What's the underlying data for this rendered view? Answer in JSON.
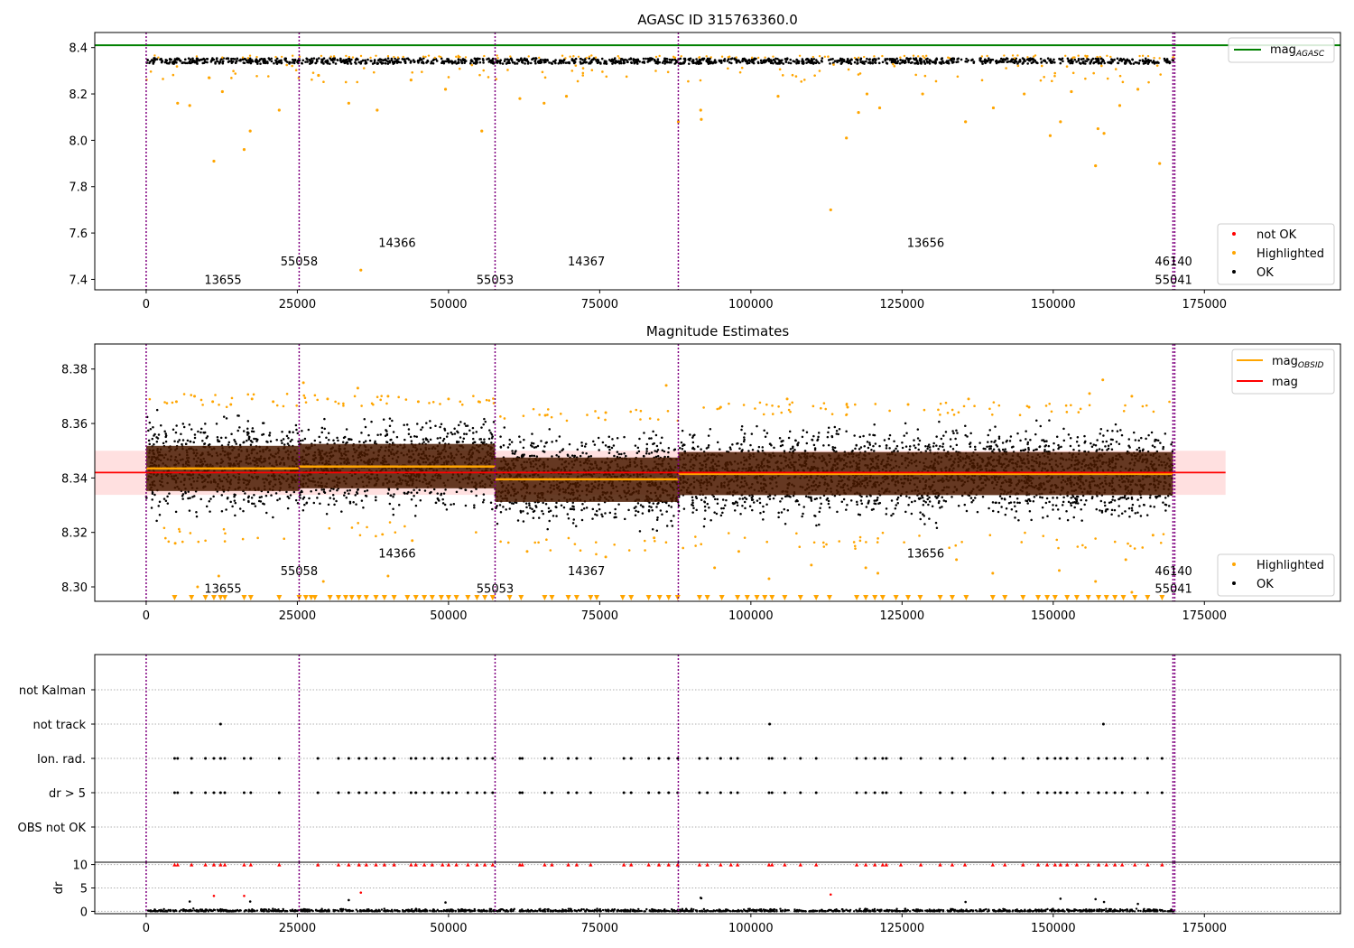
{
  "chart_data": [
    {
      "type": "scatter",
      "title": "AGASC ID 315763360.0",
      "xlabel": "",
      "ylabel": "",
      "xlim": [
        -8500,
        197500
      ],
      "ylim": [
        7.355,
        8.465
      ],
      "xticks": [
        0,
        25000,
        50000,
        75000,
        100000,
        125000,
        150000,
        175000
      ],
      "xtick_labels": [
        "0",
        "25000",
        "50000",
        "75000",
        "100000",
        "125000",
        "150000",
        "175000"
      ],
      "yticks": [
        7.4,
        7.6,
        7.8,
        8.0,
        8.2,
        8.4
      ],
      "ytick_labels": [
        "7.4",
        "7.6",
        "7.8",
        "8.0",
        "8.2",
        "8.4"
      ],
      "obs_boundaries": [
        0,
        25300,
        57700,
        88000,
        169800,
        170100
      ],
      "obsid_labels": [
        {
          "text": "13655",
          "x": 12700,
          "y": 7.4
        },
        {
          "text": "55058",
          "x": 25300,
          "y": 7.48
        },
        {
          "text": "14366",
          "x": 41500,
          "y": 7.56
        },
        {
          "text": "55053",
          "x": 57700,
          "y": 7.4
        },
        {
          "text": "14367",
          "x": 72800,
          "y": 7.48
        },
        {
          "text": "13656",
          "x": 128900,
          "y": 7.56
        },
        {
          "text": "46140",
          "x": 169900,
          "y": 7.48
        },
        {
          "text": "55041",
          "x": 169900,
          "y": 7.4
        }
      ],
      "ref_line": {
        "name": "mag_AGASC",
        "y": 8.41,
        "x": [
          -8500,
          197500
        ],
        "color": "#008000"
      },
      "ok_band": {
        "center": 8.342,
        "half_width": 0.012,
        "color": "#000000"
      },
      "highlighted_outliers": [
        {
          "x": 5200,
          "y": 8.16
        },
        {
          "x": 7200,
          "y": 8.15
        },
        {
          "x": 10400,
          "y": 8.27
        },
        {
          "x": 11200,
          "y": 7.91
        },
        {
          "x": 12600,
          "y": 8.21
        },
        {
          "x": 16200,
          "y": 7.96
        },
        {
          "x": 17200,
          "y": 8.04
        },
        {
          "x": 22000,
          "y": 8.13
        },
        {
          "x": 28500,
          "y": 8.28
        },
        {
          "x": 33500,
          "y": 8.16
        },
        {
          "x": 35500,
          "y": 7.44
        },
        {
          "x": 38200,
          "y": 8.13
        },
        {
          "x": 43800,
          "y": 8.26
        },
        {
          "x": 49500,
          "y": 8.22
        },
        {
          "x": 55500,
          "y": 8.04
        },
        {
          "x": 61800,
          "y": 8.18
        },
        {
          "x": 65800,
          "y": 8.16
        },
        {
          "x": 69500,
          "y": 8.19
        },
        {
          "x": 88000,
          "y": 8.08
        },
        {
          "x": 91700,
          "y": 8.13
        },
        {
          "x": 91800,
          "y": 8.09
        },
        {
          "x": 104500,
          "y": 8.19
        },
        {
          "x": 113200,
          "y": 7.7
        },
        {
          "x": 115800,
          "y": 8.01
        },
        {
          "x": 117800,
          "y": 8.12
        },
        {
          "x": 119200,
          "y": 8.2
        },
        {
          "x": 121300,
          "y": 8.14
        },
        {
          "x": 128400,
          "y": 8.2
        },
        {
          "x": 135500,
          "y": 8.08
        },
        {
          "x": 140100,
          "y": 8.14
        },
        {
          "x": 145200,
          "y": 8.2
        },
        {
          "x": 149500,
          "y": 8.02
        },
        {
          "x": 151200,
          "y": 8.08
        },
        {
          "x": 153000,
          "y": 8.21
        },
        {
          "x": 157000,
          "y": 7.89
        },
        {
          "x": 157400,
          "y": 8.05
        },
        {
          "x": 158400,
          "y": 8.03
        },
        {
          "x": 161000,
          "y": 8.15
        },
        {
          "x": 164000,
          "y": 8.22
        },
        {
          "x": 167600,
          "y": 7.9
        }
      ],
      "legends": [
        {
          "position": "upper-right",
          "entries": [
            {
              "label": "mag",
              "sub": "AGASC",
              "color": "#008000",
              "kind": "line"
            }
          ]
        },
        {
          "position": "lower-right",
          "entries": [
            {
              "label": "not OK",
              "color": "#ff0000",
              "kind": "dot"
            },
            {
              "label": "Highlighted",
              "color": "#ffa500",
              "kind": "dot"
            },
            {
              "label": "OK",
              "color": "#000000",
              "kind": "dot"
            }
          ]
        }
      ]
    },
    {
      "type": "scatter",
      "title": "Magnitude Estimates",
      "xlabel": "",
      "ylabel": "",
      "xlim": [
        -8500,
        197500
      ],
      "ylim": [
        8.2947,
        8.3892
      ],
      "xticks": [
        0,
        25000,
        50000,
        75000,
        100000,
        125000,
        150000,
        175000
      ],
      "xtick_labels": [
        "0",
        "25000",
        "50000",
        "75000",
        "100000",
        "125000",
        "150000",
        "175000"
      ],
      "yticks": [
        8.3,
        8.32,
        8.34,
        8.36,
        8.38
      ],
      "ytick_labels": [
        "8.30",
        "8.32",
        "8.34",
        "8.36",
        "8.38"
      ],
      "obs_boundaries": [
        0,
        25300,
        57700,
        88000,
        169800,
        170100
      ],
      "obsid_labels": [
        {
          "text": "13655",
          "x": 12700,
          "y": 8.2995
        },
        {
          "text": "55058",
          "x": 25300,
          "y": 8.306
        },
        {
          "text": "14366",
          "x": 41500,
          "y": 8.3125
        },
        {
          "text": "55053",
          "x": 57700,
          "y": 8.2995
        },
        {
          "text": "14367",
          "x": 72800,
          "y": 8.306
        },
        {
          "text": "13656",
          "x": 128900,
          "y": 8.3125
        },
        {
          "text": "46140",
          "x": 169900,
          "y": 8.306
        },
        {
          "text": "55041",
          "x": 169900,
          "y": 8.2995
        }
      ],
      "mag_line": {
        "name": "mag",
        "y": 8.342,
        "x": [
          -8500,
          178500
        ],
        "band": [
          8.3338,
          8.35
        ],
        "color": "#ff0000"
      },
      "mag_obsid_segments": [
        {
          "x0": 0,
          "x1": 25300,
          "y": 8.3435,
          "lo": 8.3352,
          "hi": 8.3518
        },
        {
          "x0": 25300,
          "x1": 57700,
          "y": 8.3442,
          "lo": 8.3362,
          "hi": 8.3525
        },
        {
          "x0": 57700,
          "x1": 88000,
          "y": 8.3395,
          "lo": 8.3312,
          "hi": 8.3475
        },
        {
          "x0": 88000,
          "x1": 169800,
          "y": 8.3415,
          "lo": 8.3337,
          "hi": 8.3495
        }
      ],
      "ok_spread": [
        {
          "x0": 0,
          "x1": 25300,
          "y_lo": 8.322,
          "y_hi": 8.366
        },
        {
          "x0": 25300,
          "x1": 57700,
          "y_lo": 8.324,
          "y_hi": 8.366
        },
        {
          "x0": 57700,
          "x1": 88000,
          "y_lo": 8.318,
          "y_hi": 8.361
        },
        {
          "x0": 88000,
          "x1": 169800,
          "y_lo": 8.32,
          "y_hi": 8.363
        }
      ],
      "highlighted_outliers": [
        {
          "x": 5000,
          "y": 8.368
        },
        {
          "x": 8000,
          "y": 8.37
        },
        {
          "x": 11000,
          "y": 8.368
        },
        {
          "x": 14000,
          "y": 8.367
        },
        {
          "x": 17500,
          "y": 8.369
        },
        {
          "x": 21000,
          "y": 8.368
        },
        {
          "x": 26000,
          "y": 8.375
        },
        {
          "x": 30000,
          "y": 8.369
        },
        {
          "x": 35000,
          "y": 8.373
        },
        {
          "x": 40000,
          "y": 8.37
        },
        {
          "x": 45000,
          "y": 8.368
        },
        {
          "x": 50000,
          "y": 8.369
        },
        {
          "x": 55000,
          "y": 8.368
        },
        {
          "x": 66000,
          "y": 8.363
        },
        {
          "x": 76000,
          "y": 8.364
        },
        {
          "x": 86000,
          "y": 8.374
        },
        {
          "x": 95000,
          "y": 8.366
        },
        {
          "x": 106000,
          "y": 8.369
        },
        {
          "x": 116000,
          "y": 8.366
        },
        {
          "x": 126000,
          "y": 8.367
        },
        {
          "x": 136000,
          "y": 8.369
        },
        {
          "x": 146000,
          "y": 8.366
        },
        {
          "x": 156000,
          "y": 8.371
        },
        {
          "x": 158200,
          "y": 8.376
        },
        {
          "x": 163000,
          "y": 8.37
        },
        {
          "x": 4800,
          "y": 8.316
        },
        {
          "x": 8500,
          "y": 8.3
        },
        {
          "x": 12000,
          "y": 8.304
        },
        {
          "x": 29300,
          "y": 8.302
        },
        {
          "x": 40000,
          "y": 8.304
        },
        {
          "x": 44000,
          "y": 8.317
        },
        {
          "x": 63000,
          "y": 8.313
        },
        {
          "x": 76000,
          "y": 8.311
        },
        {
          "x": 84000,
          "y": 8.318
        },
        {
          "x": 94000,
          "y": 8.307
        },
        {
          "x": 98000,
          "y": 8.313
        },
        {
          "x": 103000,
          "y": 8.303
        },
        {
          "x": 110000,
          "y": 8.308
        },
        {
          "x": 119000,
          "y": 8.307
        },
        {
          "x": 121000,
          "y": 8.305
        },
        {
          "x": 134000,
          "y": 8.31
        },
        {
          "x": 140000,
          "y": 8.305
        },
        {
          "x": 151000,
          "y": 8.306
        },
        {
          "x": 157000,
          "y": 8.302
        },
        {
          "x": 162000,
          "y": 8.31
        },
        {
          "x": 163000,
          "y": 8.298
        },
        {
          "x": 166500,
          "y": 8.319
        }
      ],
      "below_range_markers": [
        4700,
        7500,
        9800,
        11200,
        12300,
        13000,
        16200,
        17300,
        22000,
        25300,
        26400,
        27300,
        27900,
        30400,
        31800,
        33000,
        34000,
        35200,
        36400,
        38000,
        39400,
        41000,
        43200,
        44600,
        46000,
        47300,
        48800,
        50000,
        51300,
        53200,
        54700,
        56000,
        57300,
        60100,
        62000,
        65900,
        67100,
        69800,
        71200,
        73500,
        74500,
        78800,
        80200,
        83100,
        84900,
        86400,
        87900,
        91500,
        92800,
        95200,
        97800,
        99400,
        101000,
        102300,
        103500,
        105600,
        108200,
        110800,
        113000,
        117500,
        119000,
        120500,
        121800,
        124000,
        126000,
        128000,
        131300,
        133300,
        135600,
        140000,
        142000,
        145000,
        147500,
        149000,
        150300,
        152300,
        153900,
        155800,
        157500,
        158800,
        160200,
        161600,
        163500,
        165600,
        168000
      ],
      "legends": [
        {
          "position": "upper-right",
          "entries": [
            {
              "label": "mag",
              "sub": "OBSID",
              "color": "#ffa500",
              "kind": "line"
            },
            {
              "label": "mag",
              "color": "#ff0000",
              "kind": "line"
            }
          ]
        },
        {
          "position": "lower-right",
          "entries": [
            {
              "label": "Highlighted",
              "color": "#ffa500",
              "kind": "dot"
            },
            {
              "label": "OK",
              "color": "#000000",
              "kind": "dot"
            }
          ]
        }
      ]
    },
    {
      "type": "scatter",
      "title": "",
      "xlabel": "",
      "ylabel": "",
      "xlim": [
        -8500,
        197500
      ],
      "categories": [
        "OBS not OK",
        "dr > 5",
        "Ion. rad.",
        "not track",
        "not Kalman"
      ],
      "obs_boundaries": [
        0,
        25300,
        57700,
        88000,
        169800,
        170100
      ],
      "flags": {
        "not track": [
          12300,
          103100,
          158300
        ],
        "Ion. rad.": [
          4700,
          5200,
          7500,
          9800,
          11200,
          12300,
          13000,
          16200,
          17300,
          22000,
          28400,
          31800,
          33500,
          35200,
          36400,
          38000,
          39400,
          41000,
          43800,
          44600,
          46000,
          47300,
          49000,
          50000,
          51300,
          53200,
          54700,
          56000,
          57300,
          61800,
          62200,
          65900,
          67100,
          69800,
          71200,
          73500,
          79000,
          80200,
          83100,
          84800,
          86400,
          87900,
          91500,
          92800,
          95000,
          96700,
          97800,
          103000,
          103500,
          105600,
          108200,
          110800,
          117500,
          119000,
          120500,
          121800,
          122400,
          124800,
          128100,
          131300,
          133300,
          135400,
          140000,
          142000,
          145000,
          147500,
          149000,
          150300,
          151200,
          152300,
          153900,
          155800,
          157500,
          158800,
          160200,
          161400,
          163500,
          165600,
          168000
        ],
        "dr > 5": [
          4700,
          5200,
          7500,
          9800,
          11200,
          12300,
          13000,
          16200,
          17300,
          22000,
          28400,
          31800,
          33500,
          35200,
          36400,
          38000,
          39400,
          41000,
          43800,
          44600,
          46000,
          47300,
          49000,
          50000,
          51300,
          53200,
          54700,
          56000,
          57300,
          61800,
          62200,
          65900,
          67100,
          69800,
          71200,
          73500,
          79000,
          80200,
          83100,
          84800,
          86400,
          87900,
          91500,
          92800,
          95000,
          96700,
          97800,
          103000,
          103500,
          105600,
          108200,
          110800,
          117500,
          119000,
          120500,
          121800,
          122400,
          124800,
          128100,
          131300,
          133300,
          135400,
          140000,
          142000,
          145000,
          147500,
          149000,
          150300,
          151200,
          152300,
          153900,
          155800,
          157500,
          158800,
          160200,
          161400,
          163500,
          165600,
          168000
        ]
      }
    },
    {
      "type": "scatter",
      "title": "",
      "xlabel": "",
      "ylabel": "dr",
      "xlim": [
        -8500,
        197500
      ],
      "ylim": [
        -0.5,
        10.5
      ],
      "xticks": [
        0,
        25000,
        50000,
        75000,
        100000,
        125000,
        150000,
        175000
      ],
      "xtick_labels": [
        "0",
        "25000",
        "50000",
        "75000",
        "100000",
        "125000",
        "150000",
        "175000"
      ],
      "yticks": [
        0,
        5,
        10
      ],
      "ytick_labels": [
        "0",
        "5",
        "10"
      ],
      "obs_boundaries": [
        0,
        25300,
        57700,
        88000,
        169800,
        170100
      ],
      "dr_capped_markers": [
        4700,
        5200,
        7500,
        9800,
        11200,
        12300,
        13000,
        16200,
        17300,
        22000,
        28400,
        31800,
        33500,
        35200,
        36400,
        38000,
        39400,
        41000,
        43800,
        44600,
        46000,
        47300,
        49000,
        50000,
        51300,
        53200,
        54700,
        56000,
        57300,
        61800,
        62200,
        65900,
        67100,
        69800,
        71200,
        73500,
        79000,
        80200,
        83100,
        84800,
        86400,
        87900,
        91500,
        92800,
        95000,
        96700,
        97800,
        103000,
        103500,
        105600,
        108200,
        110800,
        117500,
        119000,
        120500,
        121800,
        122400,
        124800,
        128100,
        131300,
        133300,
        135400,
        140000,
        142000,
        145000,
        147500,
        149000,
        150300,
        151200,
        152300,
        153900,
        155800,
        157500,
        158800,
        160200,
        161400,
        163500,
        165600,
        168000
      ],
      "dr_large_red": [
        {
          "x": 11200,
          "y": 3.3
        },
        {
          "x": 16200,
          "y": 3.3
        },
        {
          "x": 35500,
          "y": 4.0
        },
        {
          "x": 113200,
          "y": 3.6
        }
      ],
      "dr_large_black": [
        {
          "x": 7200,
          "y": 2.1
        },
        {
          "x": 17200,
          "y": 2.1
        },
        {
          "x": 33500,
          "y": 2.4
        },
        {
          "x": 49500,
          "y": 1.9
        },
        {
          "x": 91700,
          "y": 2.9
        },
        {
          "x": 91800,
          "y": 2.8
        },
        {
          "x": 135500,
          "y": 2.0
        },
        {
          "x": 151200,
          "y": 2.7
        },
        {
          "x": 157000,
          "y": 2.6
        },
        {
          "x": 158400,
          "y": 2.0
        },
        {
          "x": 164000,
          "y": 1.6
        }
      ],
      "dr_typical_range": [
        0.0,
        0.6
      ]
    }
  ]
}
